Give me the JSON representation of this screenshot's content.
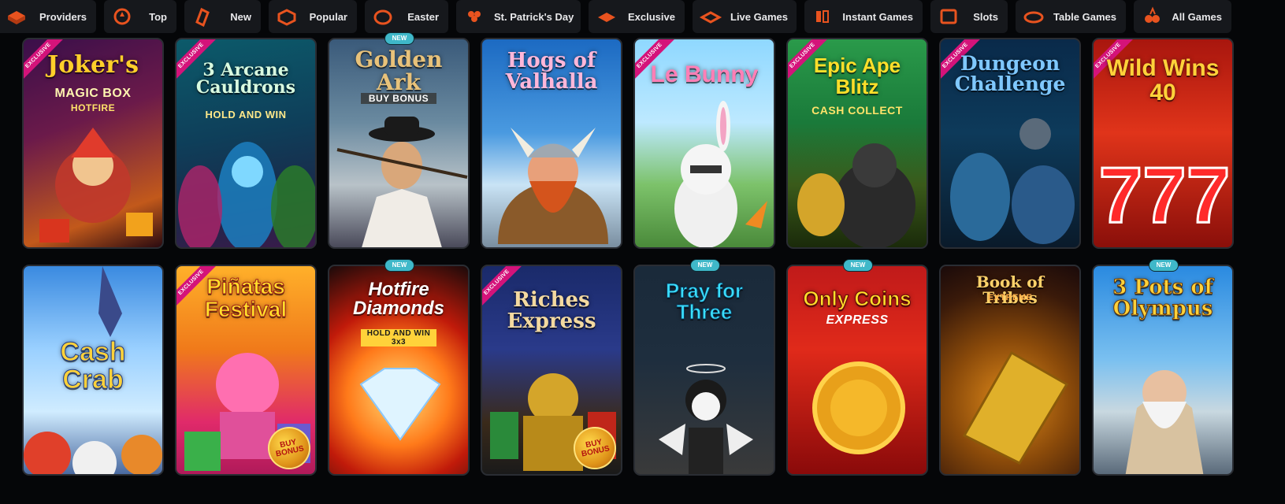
{
  "tabs": [
    {
      "label": "Providers",
      "icon": "providers-icon"
    },
    {
      "label": "Top",
      "icon": "top-icon"
    },
    {
      "label": "New",
      "icon": "new-icon"
    },
    {
      "label": "Popular",
      "icon": "popular-icon"
    },
    {
      "label": "Easter",
      "icon": "easter-icon"
    },
    {
      "label": "St. Patrick's Day",
      "icon": "st-patricks-icon"
    },
    {
      "label": "Exclusive",
      "icon": "exclusive-icon"
    },
    {
      "label": "Live Games",
      "icon": "live-games-icon"
    },
    {
      "label": "Instant Games",
      "icon": "instant-games-icon"
    },
    {
      "label": "Slots",
      "icon": "slots-icon"
    },
    {
      "label": "Table Games",
      "icon": "table-games-icon"
    },
    {
      "label": "All Games",
      "icon": "all-games-icon"
    }
  ],
  "colors": {
    "accent": "#e8531f",
    "tab_bg": "#16181c",
    "exclusive_ribbon": "#d4137a",
    "new_badge": "#3fb8c9"
  },
  "badges": {
    "exclusive": "EXCLUSIVE",
    "new": "NEW"
  },
  "rows": [
    [
      {
        "title": "Joker's",
        "subtitle": "MAGIC BOX",
        "extra": "HOTFIRE",
        "badge": "exclusive"
      },
      {
        "title": "3 Arcane Cauldrons",
        "subtitle": "HOLD AND WIN",
        "extra": "",
        "badge": "exclusive"
      },
      {
        "title": "Golden Ark",
        "subtitle": "BUY BONUS",
        "extra": "",
        "badge": "new"
      },
      {
        "title": "Hogs of Valhalla",
        "subtitle": "",
        "extra": "",
        "badge": ""
      },
      {
        "title": "Le Bunny",
        "subtitle": "",
        "extra": "",
        "badge": "exclusive"
      },
      {
        "title": "Epic Ape Blitz",
        "subtitle": "CASH COLLECT",
        "extra": "",
        "badge": "exclusive"
      },
      {
        "title": "Dungeon Challenge",
        "subtitle": "",
        "extra": "",
        "badge": "exclusive"
      },
      {
        "title": "Wild Wins 40",
        "subtitle": "",
        "extra": "",
        "badge": "exclusive"
      }
    ],
    [
      {
        "title": "Cash Crab",
        "subtitle": "",
        "extra": "",
        "badge": ""
      },
      {
        "title": "Piñatas Festival",
        "subtitle": "",
        "extra": "BUY BONUS",
        "badge": "exclusive"
      },
      {
        "title": "Hotfire Diamonds",
        "subtitle": "HOLD AND WIN 3x3",
        "extra": "",
        "badge": "new"
      },
      {
        "title": "Riches Express",
        "subtitle": "",
        "extra": "BUY BONUS",
        "badge": "exclusive"
      },
      {
        "title": "Pray for Three",
        "subtitle": "",
        "extra": "",
        "badge": "new"
      },
      {
        "title": "Only Coins",
        "subtitle": "EXPRESS",
        "extra": "",
        "badge": "new"
      },
      {
        "title": "Book of Tribes",
        "subtitle": "EXTREME",
        "extra": "",
        "badge": ""
      },
      {
        "title": "3 Pots of Olympus",
        "subtitle": "",
        "extra": "",
        "badge": "new"
      }
    ]
  ]
}
